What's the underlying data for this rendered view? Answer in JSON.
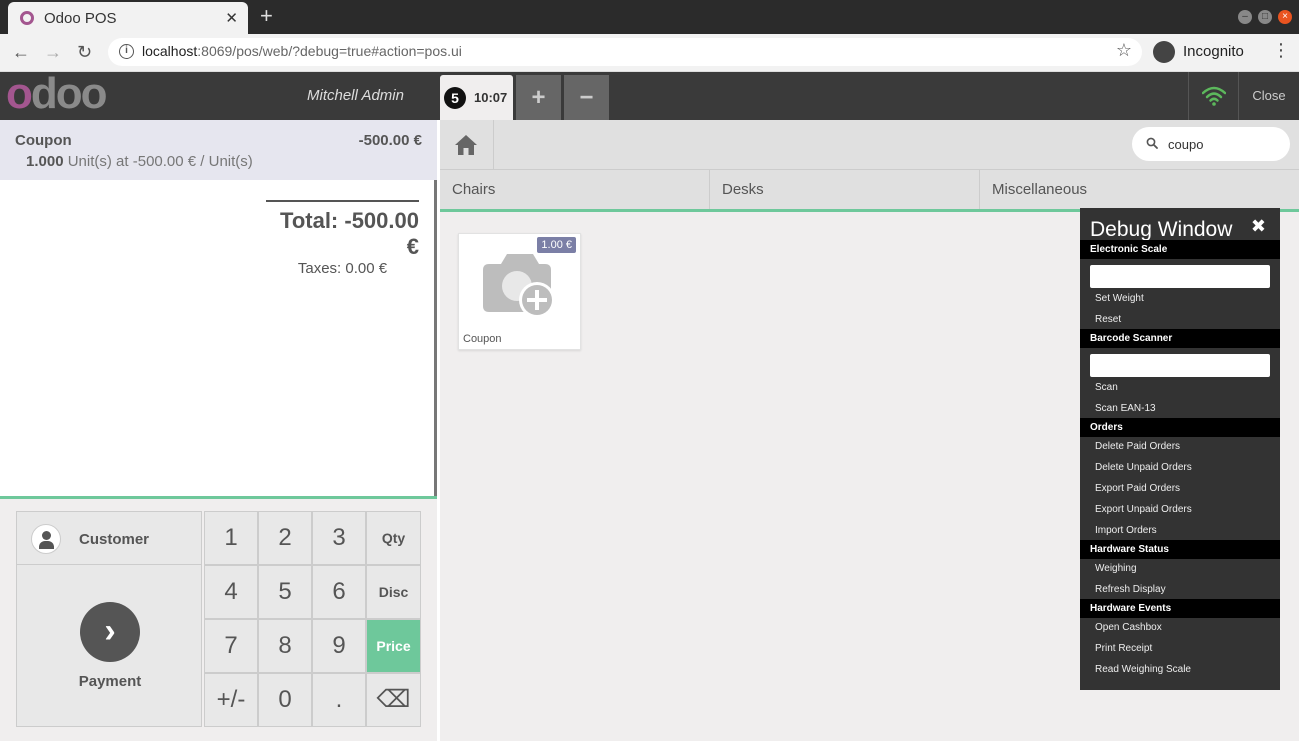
{
  "browser": {
    "tab_title": "Odoo POS",
    "tab_close": "✕",
    "new_tab": "+",
    "url_host": "localhost",
    "url_rest": ":8069/pos/web/?debug=true#action=pos.ui",
    "profile_label": "Incognito"
  },
  "header": {
    "logo_first": "o",
    "logo_rest": "doo",
    "user": "Mitchell Admin",
    "order_number": "5",
    "order_time": "10:07",
    "add_label": "+",
    "remove_label": "−",
    "close_label": "Close",
    "wifi_color": "#5cb85c"
  },
  "order": {
    "line": {
      "product": "Coupon",
      "price": "-500.00 €",
      "qty": "1.000",
      "unit_info": "Unit(s) at -500.00 € / Unit(s)"
    },
    "total": "Total: -500.00 €",
    "taxes": "Taxes: 0.00 €"
  },
  "actions": {
    "customer_label": "Customer",
    "payment_label": "Payment"
  },
  "numpad": {
    "keys": [
      "1",
      "2",
      "3",
      "Qty",
      "4",
      "5",
      "6",
      "Disc",
      "7",
      "8",
      "9",
      "Price",
      "+/-",
      "0",
      ".",
      "⌫"
    ],
    "active_mode": "Price"
  },
  "products": {
    "search_value": "coupo",
    "categories": [
      "Chairs",
      "Desks",
      "Miscellaneous"
    ],
    "items": [
      {
        "name": "Coupon",
        "price": "1.00 €"
      }
    ]
  },
  "debug": {
    "title": "Debug Window",
    "close": "✖",
    "sections": {
      "scale": "Electronic Scale",
      "barcode": "Barcode Scanner",
      "orders": "Orders",
      "hw_status": "Hardware Status",
      "hw_events": "Hardware Events"
    },
    "items": {
      "set_weight": "Set Weight",
      "reset": "Reset",
      "scan": "Scan",
      "scan_ean": "Scan EAN-13",
      "delete_paid": "Delete Paid Orders",
      "delete_unpaid": "Delete Unpaid Orders",
      "export_paid": "Export Paid Orders",
      "export_unpaid": "Export Unpaid Orders",
      "import": "Import Orders",
      "weighing": "Weighing",
      "refresh_display": "Refresh Display",
      "open_cashbox": "Open Cashbox",
      "print_receipt": "Print Receipt",
      "read_scale": "Read Weighing Scale"
    }
  },
  "colors": {
    "accent": "#6ec89b",
    "brand": "#a3568f",
    "price_badge": "#7b7fa6"
  }
}
